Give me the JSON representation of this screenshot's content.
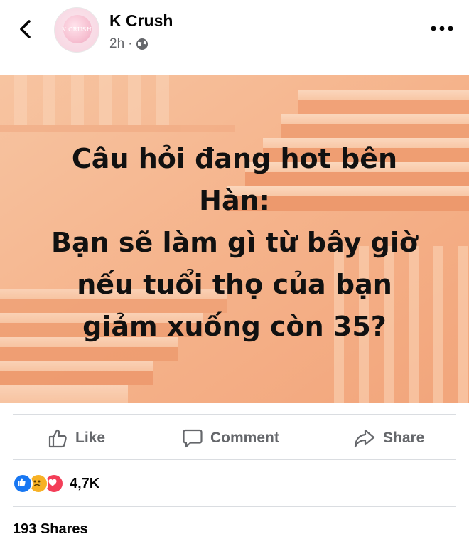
{
  "header": {
    "page_name": "K Crush",
    "avatar_brand": "K CRUSH",
    "time": "2h",
    "privacy_icon": "globe-icon",
    "back_icon": "chevron-left-icon",
    "more_icon": "more-horizontal-icon"
  },
  "post": {
    "image_lines": [
      "Câu hỏi đang hot bên",
      "Hàn:",
      "Bạn sẽ làm gì từ bây giờ",
      "nếu tuổi thọ của bạn",
      "giảm xuống còn 35?"
    ],
    "image_background": "#f6b58f"
  },
  "actions": {
    "like_label": "Like",
    "comment_label": "Comment",
    "share_label": "Share"
  },
  "stats": {
    "reactions": [
      "like",
      "sad",
      "love"
    ],
    "reaction_count": "4,7K",
    "shares_label": "193 Shares"
  },
  "colors": {
    "secondary_text": "#65676b",
    "like_blue": "#1877f2",
    "love_red": "#f33e58",
    "sad_yellow": "#f7b125"
  }
}
